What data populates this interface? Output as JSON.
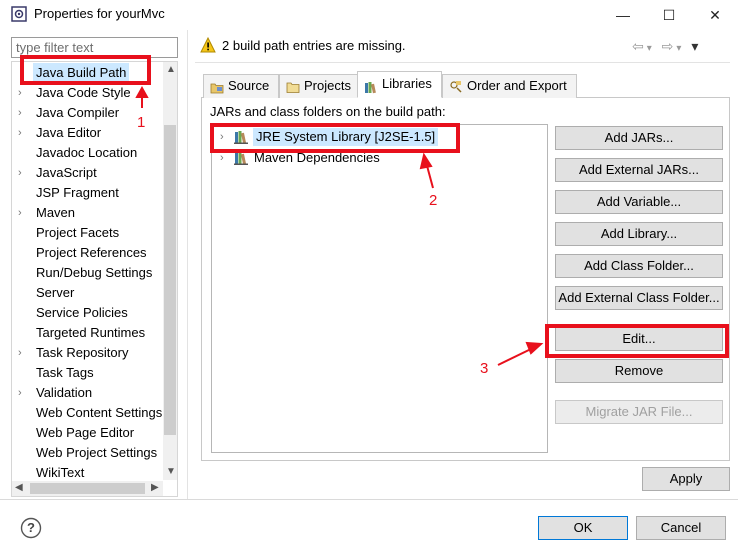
{
  "window": {
    "title": "Properties for yourMvc",
    "minimize": "—",
    "maximize": "☐",
    "close": "✕"
  },
  "filter": {
    "placeholder": "type filter text"
  },
  "tree": {
    "items": [
      {
        "label": "Java Build Path",
        "expandable": false,
        "selected": true
      },
      {
        "label": "Java Code Style",
        "expandable": true
      },
      {
        "label": "Java Compiler",
        "expandable": true
      },
      {
        "label": "Java Editor",
        "expandable": true
      },
      {
        "label": "Javadoc Location",
        "expandable": false
      },
      {
        "label": "JavaScript",
        "expandable": true
      },
      {
        "label": "JSP Fragment",
        "expandable": false
      },
      {
        "label": "Maven",
        "expandable": true
      },
      {
        "label": "Project Facets",
        "expandable": false
      },
      {
        "label": "Project References",
        "expandable": false
      },
      {
        "label": "Run/Debug Settings",
        "expandable": false
      },
      {
        "label": "Server",
        "expandable": false
      },
      {
        "label": "Service Policies",
        "expandable": false
      },
      {
        "label": "Targeted Runtimes",
        "expandable": false
      },
      {
        "label": "Task Repository",
        "expandable": true
      },
      {
        "label": "Task Tags",
        "expandable": false
      },
      {
        "label": "Validation",
        "expandable": true
      },
      {
        "label": "Web Content Settings",
        "expandable": false
      },
      {
        "label": "Web Page Editor",
        "expandable": false
      },
      {
        "label": "Web Project Settings",
        "expandable": false
      },
      {
        "label": "WikiText",
        "expandable": false
      }
    ]
  },
  "header": {
    "message": "2 build path entries are missing.",
    "nav_back": "⇦",
    "nav_fwd": "⇨",
    "menu": "▾"
  },
  "tabs": [
    {
      "label": "Source",
      "active": false
    },
    {
      "label": "Projects",
      "active": false
    },
    {
      "label": "Libraries",
      "active": true
    },
    {
      "label": "Order and Export",
      "active": false
    }
  ],
  "libraries": {
    "label": "JARs and class folders on the build path:",
    "entries": [
      {
        "label": "JRE System Library [J2SE-1.5]",
        "selected": true
      },
      {
        "label": "Maven Dependencies",
        "selected": false
      }
    ]
  },
  "buttons": {
    "add_jars": "Add JARs...",
    "add_external_jars": "Add External JARs...",
    "add_variable": "Add Variable...",
    "add_library": "Add Library...",
    "add_class_folder": "Add Class Folder...",
    "add_external_class_folder": "Add External Class Folder...",
    "edit": "Edit...",
    "remove": "Remove",
    "migrate_jar": "Migrate JAR File..."
  },
  "footer": {
    "apply": "Apply",
    "ok": "OK",
    "cancel": "Cancel",
    "help": "?"
  },
  "annotations": {
    "one": "1",
    "two": "2",
    "three": "3"
  },
  "colors": {
    "annotation_red": "#e8101c",
    "selection": "#cce8ff",
    "focus_border": "#0078d7"
  }
}
